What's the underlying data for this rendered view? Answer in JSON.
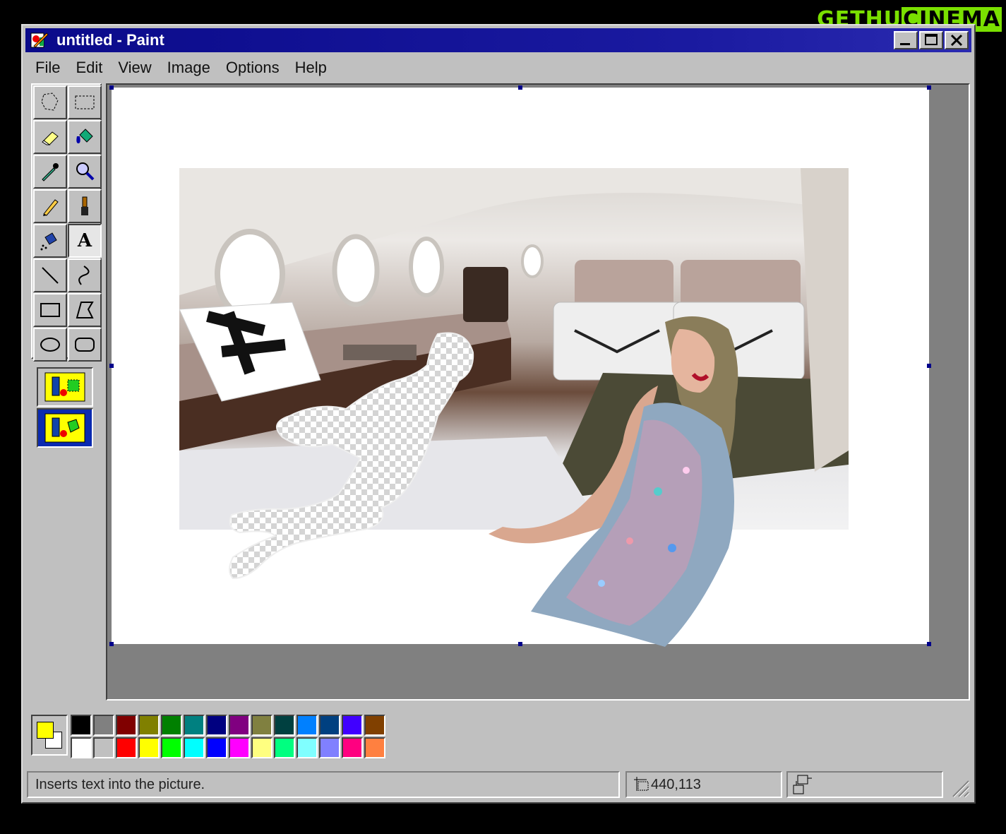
{
  "watermark": {
    "part1": "GETHU",
    "part2": "CINEMA"
  },
  "window": {
    "title": "untitled - Paint"
  },
  "menu": [
    "File",
    "Edit",
    "View",
    "Image",
    "Options",
    "Help"
  ],
  "toolbox": {
    "tools": [
      {
        "name": "free-form-select-icon"
      },
      {
        "name": "rectangle-select-icon"
      },
      {
        "name": "eraser-icon"
      },
      {
        "name": "fill-with-color-icon"
      },
      {
        "name": "pick-color-icon"
      },
      {
        "name": "magnifier-icon"
      },
      {
        "name": "pencil-icon"
      },
      {
        "name": "brush-icon"
      },
      {
        "name": "airbrush-icon"
      },
      {
        "name": "text-icon",
        "glyph": "A",
        "active": true
      },
      {
        "name": "line-icon"
      },
      {
        "name": "curve-icon"
      },
      {
        "name": "rectangle-icon"
      },
      {
        "name": "polygon-icon"
      },
      {
        "name": "ellipse-icon"
      },
      {
        "name": "rounded-rectangle-icon"
      }
    ]
  },
  "colors": {
    "foreground": "#ffff00",
    "background": "#ffffff",
    "palette_top": [
      "#000000",
      "#808080",
      "#800000",
      "#808000",
      "#008000",
      "#008080",
      "#000080",
      "#800080",
      "#808040",
      "#004040",
      "#0080ff",
      "#004080",
      "#4000ff",
      "#804000"
    ],
    "palette_bottom": [
      "#ffffff",
      "#c0c0c0",
      "#ff0000",
      "#ffff00",
      "#00ff00",
      "#00ffff",
      "#0000ff",
      "#ff00ff",
      "#ffff80",
      "#00ff80",
      "#80ffff",
      "#8080ff",
      "#ff0080",
      "#ff8040"
    ]
  },
  "status": {
    "help_text": "Inserts text into the picture.",
    "coords": "440,113"
  }
}
